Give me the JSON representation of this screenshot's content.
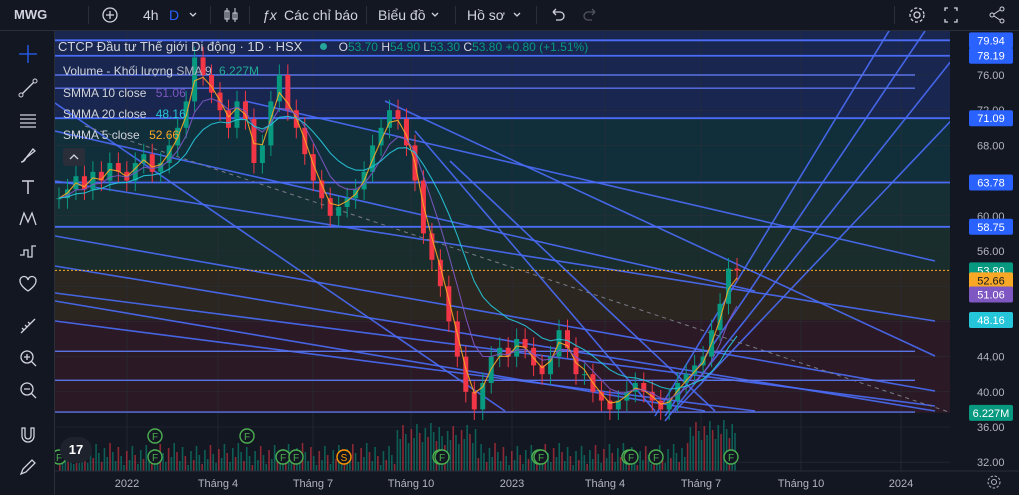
{
  "toolbar": {
    "symbol": "MWG",
    "interval": "4h",
    "interval_alt": "D",
    "indicators_label": "Các chỉ báo",
    "chart_label": "Biểu đồ",
    "profile_label": "Hồ sơ"
  },
  "legend": {
    "title": "CTCP Đầu tư Thế giới Di động · 1D · HSX",
    "o_label": "O",
    "o_value": "53.70",
    "h_label": "H",
    "h_value": "54.90",
    "l_label": "L",
    "l_value": "53.30",
    "c_label": "C",
    "c_value": "53.80",
    "change": "+0.80 (+1.51%)",
    "indicators": [
      {
        "label": "Volume - Khối lượng",
        "param": "SMA 9",
        "value": "6.227M",
        "color": "#22ab94"
      },
      {
        "label": "SMMA",
        "param": "10 close",
        "value": "51.06",
        "color": "#7e57c2"
      },
      {
        "label": "SMMA",
        "param": "20 close",
        "value": "48.16",
        "color": "#26c6da"
      },
      {
        "label": "SMMA",
        "param": "5 close",
        "value": "52.66",
        "color": "#f9a825"
      }
    ]
  },
  "chart_data": {
    "type": "line",
    "title": "CTCP Đầu tư Thế giới Di động · 1D · HSX",
    "x_ticks": [
      "2022",
      "Tháng 4",
      "Tháng 7",
      "Tháng 10",
      "2023",
      "Tháng 4",
      "Tháng 7",
      "Tháng 10",
      "2024"
    ],
    "y_ticks": [
      "76.00",
      "72.00",
      "68.00",
      "64.00",
      "60.00",
      "56.00",
      "52.00",
      "48.00",
      "44.00",
      "40.00",
      "36.00",
      "32.00"
    ],
    "ylim": [
      31,
      81
    ],
    "price_labels": [
      {
        "value": 79.94,
        "text": "79.94",
        "color": "#2962ff"
      },
      {
        "value": 78.19,
        "text": "78.19",
        "color": "#2962ff"
      },
      {
        "value": 71.09,
        "text": "71.09",
        "color": "#2962ff"
      },
      {
        "value": 63.78,
        "text": "63.78",
        "color": "#2962ff"
      },
      {
        "value": 58.75,
        "text": "58.75",
        "color": "#2962ff"
      },
      {
        "value": 53.8,
        "text": "53.80",
        "color": "#089981"
      },
      {
        "value": 52.66,
        "text": "52.66",
        "color": "#f9a825"
      },
      {
        "value": 51.06,
        "text": "51.06",
        "color": "#7e57c2"
      },
      {
        "value": 48.16,
        "text": "48.16",
        "color": "#26c6da"
      },
      {
        "value": 37.6,
        "text": "6.227M",
        "color": "#089981"
      }
    ],
    "horizontal_levels": [
      79.94,
      78.19,
      71.09,
      63.78,
      58.75,
      53.8
    ],
    "zones": [
      {
        "from": 71.09,
        "to": 81,
        "color": "#1e3a8a"
      },
      {
        "from": 63.78,
        "to": 71.09,
        "color": "#0f4c5c"
      },
      {
        "from": 58.75,
        "to": 63.78,
        "color": "#1a4d4d"
      },
      {
        "from": 53.8,
        "to": 58.75,
        "color": "#214a3a"
      },
      {
        "from": 48.16,
        "to": 53.8,
        "color": "#4a3a1f"
      },
      {
        "from": 37.6,
        "to": 48.16,
        "color": "#4a1f2a"
      }
    ],
    "prices": [
      62,
      63,
      64.5,
      63,
      65,
      64,
      66,
      65,
      64,
      66,
      67,
      65,
      66,
      68,
      70,
      73,
      78,
      76,
      74,
      72,
      70,
      73,
      71,
      66,
      68,
      73,
      76,
      72,
      70,
      67,
      64,
      62,
      60,
      61,
      62,
      63,
      65,
      68,
      70,
      72,
      71,
      68,
      64,
      58,
      55,
      52,
      48,
      44,
      40,
      38,
      41,
      44,
      45,
      44,
      46,
      45,
      43,
      42,
      44,
      47,
      45,
      42,
      42,
      40,
      39,
      38,
      39,
      40,
      41,
      40,
      39,
      38,
      39,
      41,
      42,
      43,
      44,
      47,
      50,
      54,
      53.8
    ],
    "event_markers": [
      "F",
      "F",
      "F",
      "F",
      "F",
      "F",
      "S",
      "F",
      "F",
      "F",
      "F",
      "F",
      "F",
      "F",
      "F"
    ]
  },
  "footer": {
    "tv_logo": "17"
  }
}
